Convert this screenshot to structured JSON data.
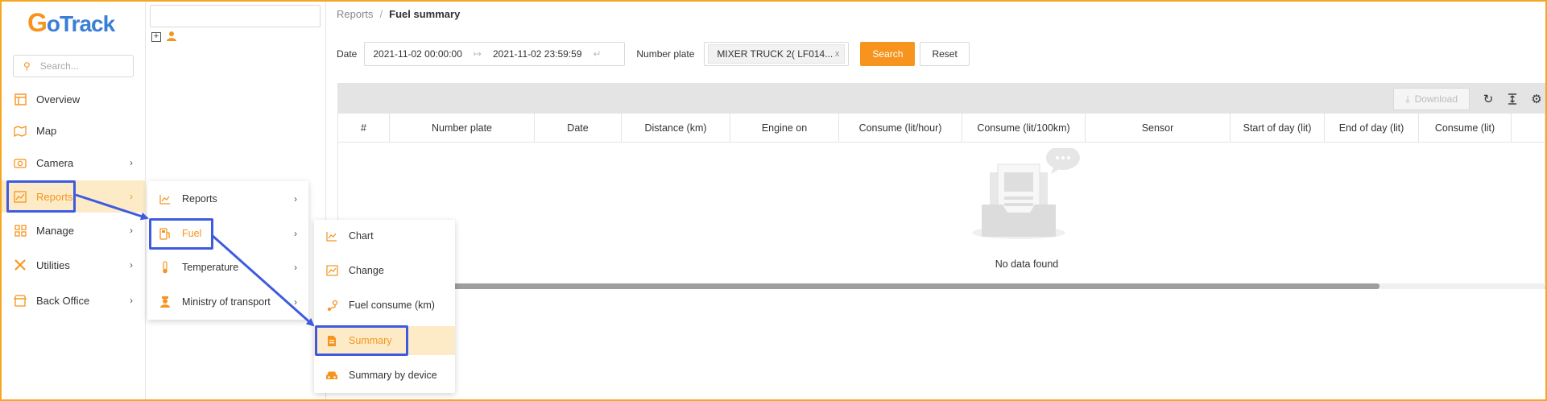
{
  "brand": {
    "logo_g": "G",
    "logo_text": "oTrack",
    "accent": "#f7941d",
    "logo_blue": "#3a7fd5",
    "annotation_color": "#3e5be0"
  },
  "sidebar": {
    "search_placeholder": "Search...",
    "items": [
      {
        "label": "Overview",
        "icon": "layout-icon",
        "chevron": ""
      },
      {
        "label": "Map",
        "icon": "map-icon",
        "chevron": ""
      },
      {
        "label": "Camera",
        "icon": "camera-icon",
        "chevron": "›"
      },
      {
        "label": "Reports",
        "icon": "chart-icon",
        "chevron": "›"
      },
      {
        "label": "Manage",
        "icon": "grid-icon",
        "chevron": "›"
      },
      {
        "label": "Utilities",
        "icon": "tools-icon",
        "chevron": "›"
      },
      {
        "label": "Back Office",
        "icon": "store-icon",
        "chevron": "›"
      }
    ]
  },
  "tree": {
    "expand_glyph": "+"
  },
  "reports_menu": {
    "items": [
      {
        "label": "Reports",
        "icon": "line-chart-icon",
        "chevron": "›"
      },
      {
        "label": "Fuel",
        "icon": "fuel-icon",
        "chevron": "›"
      },
      {
        "label": "Temperature",
        "icon": "thermometer-icon",
        "chevron": "›"
      },
      {
        "label": "Ministry of transport",
        "icon": "officer-icon",
        "chevron": "›"
      }
    ]
  },
  "fuel_menu": {
    "items": [
      {
        "label": "Chart",
        "icon": "line-chart-icon"
      },
      {
        "label": "Change",
        "icon": "area-chart-icon"
      },
      {
        "label": "Fuel consume (km)",
        "icon": "route-icon"
      },
      {
        "label": "Summary",
        "icon": "document-icon"
      },
      {
        "label": "Summary by device",
        "icon": "car-icon"
      }
    ]
  },
  "breadcrumb": {
    "parent": "Reports",
    "separator": "/",
    "current": "Fuel summary"
  },
  "filters": {
    "date_label": "Date",
    "date_start": "2021-11-02 00:00:00",
    "date_end": "2021-11-02 23:59:59",
    "plate_label": "Number plate",
    "plate_tag": "MIXER TRUCK 2( LF014...",
    "plate_tag_close": "x",
    "search_label": "Search",
    "reset_label": "Reset"
  },
  "table": {
    "download_label": "Download",
    "columns": [
      "#",
      "Number plate",
      "Date",
      "Distance (km)",
      "Engine on",
      "Consume (lit/hour)",
      "Consume (lit/100km)",
      "Sensor",
      "Start of day (lit)",
      "End of day (lit)",
      "Consume (lit)"
    ],
    "empty_text": "No data found"
  }
}
